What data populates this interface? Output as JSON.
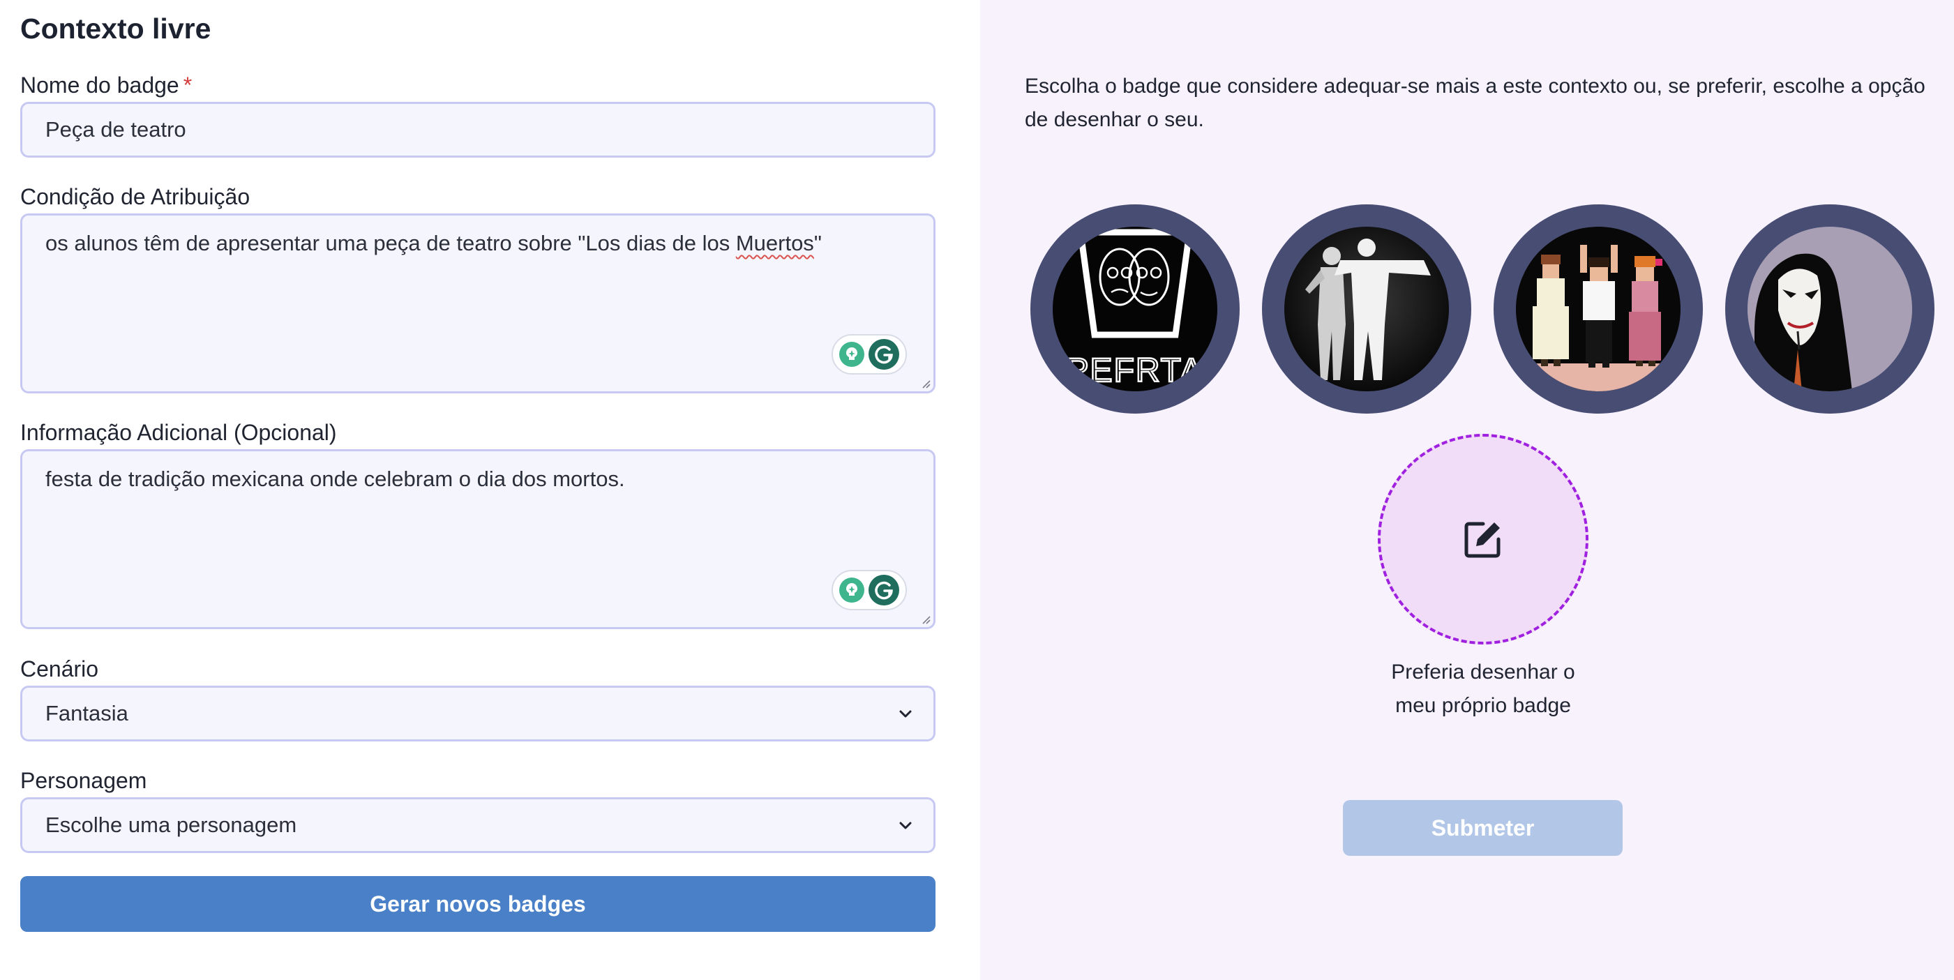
{
  "form": {
    "title": "Contexto livre",
    "badge_name": {
      "label": "Nome do badge",
      "required_mark": "*",
      "value": "Peça de teatro"
    },
    "condition": {
      "label": "Condição de Atribuição",
      "value_before": "os alunos têm de apresentar uma peça de teatro sobre \"Los dias de los ",
      "value_misspelled": "Muertos",
      "value_after": "\""
    },
    "additional_info": {
      "label": "Informação Adicional (Opcional)",
      "value": "festa de tradição mexicana onde celebram o dia dos mortos."
    },
    "scenario": {
      "label": "Cenário",
      "selected": "Fantasia"
    },
    "character": {
      "label": "Personagem",
      "selected": "Escolhe uma personagem"
    },
    "generate_label": "Gerar novos badges"
  },
  "panel": {
    "intro": "Escolha o badge que considere adequar-se mais a este contexto ou, se preferir, escolhe a opção de desenhar o seu.",
    "badge_logo_text": "PEFRTA",
    "draw_own_line1": "Preferia desenhar o",
    "draw_own_line2": "meu próprio badge",
    "submit_label": "Submeter"
  },
  "colors": {
    "primary": "#4a80c8",
    "submit_disabled": "#b2c6e8",
    "badge_ring": "#484d74",
    "panel_bg": "#f8f2fd",
    "dashed_accent": "#a020e0",
    "required": "#d63a3a"
  },
  "icons": [
    "chevron-down-icon",
    "edit-icon",
    "grammarly-icon",
    "bulb-icon",
    "resize-grip-icon"
  ]
}
